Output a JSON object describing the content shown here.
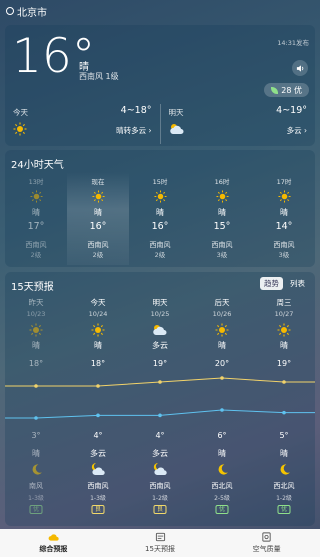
{
  "status": {
    "city": "北京市"
  },
  "current": {
    "temp": "16°",
    "condition": "晴",
    "wind": "西南风 1级",
    "publish_time": "14:31发布",
    "aqi": "28 优"
  },
  "today": {
    "label": "今天",
    "range": "4~18°",
    "desc": "晴转多云 ›"
  },
  "tomorrow": {
    "label": "明天",
    "range": "4~19°",
    "desc": "多云 ›"
  },
  "hourly": {
    "title": "24小时天气",
    "items": [
      {
        "time": "13时",
        "cond": "晴",
        "temp": "17°",
        "wind": "西南风",
        "level": "2级",
        "icon": "sun",
        "dim": true
      },
      {
        "time": "现在",
        "cond": "晴",
        "temp": "16°",
        "wind": "西南风",
        "level": "2级",
        "icon": "sun",
        "dim": false,
        "now": true
      },
      {
        "time": "15时",
        "cond": "晴",
        "temp": "16°",
        "wind": "西南风",
        "level": "2级",
        "icon": "sun",
        "dim": false
      },
      {
        "time": "16时",
        "cond": "晴",
        "temp": "15°",
        "wind": "西南风",
        "level": "3级",
        "icon": "sun",
        "dim": false
      },
      {
        "time": "17时",
        "cond": "晴",
        "temp": "14°",
        "wind": "西南风",
        "level": "3级",
        "icon": "sun",
        "dim": false
      }
    ]
  },
  "forecast": {
    "title": "15天预报",
    "toggle_trend": "趋势",
    "toggle_list": "列表",
    "days": [
      {
        "name": "昨天",
        "date": "10/23",
        "cond": "晴",
        "icon": "sun",
        "high": "18°",
        "low": "3°",
        "ncond": "晴",
        "nicon": "moon",
        "wind": "南风",
        "level": "1-3级",
        "badge": "优",
        "badge_class": "good",
        "dim": true
      },
      {
        "name": "今天",
        "date": "10/24",
        "cond": "晴",
        "icon": "sun",
        "high": "18°",
        "low": "4°",
        "ncond": "多云",
        "nicon": "cloud-night",
        "wind": "西南风",
        "level": "1-3级",
        "badge": "良",
        "badge_class": "fair",
        "dim": false
      },
      {
        "name": "明天",
        "date": "10/25",
        "cond": "多云",
        "icon": "cloud-day",
        "high": "19°",
        "low": "4°",
        "ncond": "多云",
        "nicon": "cloud-night",
        "wind": "西南风",
        "level": "1-2级",
        "badge": "良",
        "badge_class": "fair",
        "dim": false
      },
      {
        "name": "后天",
        "date": "10/26",
        "cond": "晴",
        "icon": "sun",
        "high": "20°",
        "low": "6°",
        "ncond": "晴",
        "nicon": "moon",
        "wind": "西北风",
        "level": "2-5级",
        "badge": "优",
        "badge_class": "good",
        "dim": false
      },
      {
        "name": "周三",
        "date": "10/27",
        "cond": "晴",
        "icon": "sun",
        "high": "19°",
        "low": "5°",
        "ncond": "晴",
        "nicon": "moon",
        "wind": "西北风",
        "level": "1-2级",
        "badge": "优",
        "badge_class": "good",
        "dim": false
      }
    ],
    "high_values": [
      18,
      18,
      19,
      20,
      19
    ],
    "low_values": [
      3,
      4,
      4,
      6,
      5
    ]
  },
  "nav": [
    {
      "label": "综合预报",
      "active": true,
      "icon": "cloud-tab-icon"
    },
    {
      "label": "15天预报",
      "active": false,
      "icon": "calendar-tab-icon"
    },
    {
      "label": "空气质量",
      "active": false,
      "icon": "air-tab-icon"
    }
  ],
  "colors": {
    "sun": "#f5b900",
    "high_line": "#f2d36a",
    "low_line": "#5fc2ef",
    "good": "#8fe08a",
    "fair": "#f1d96a"
  }
}
